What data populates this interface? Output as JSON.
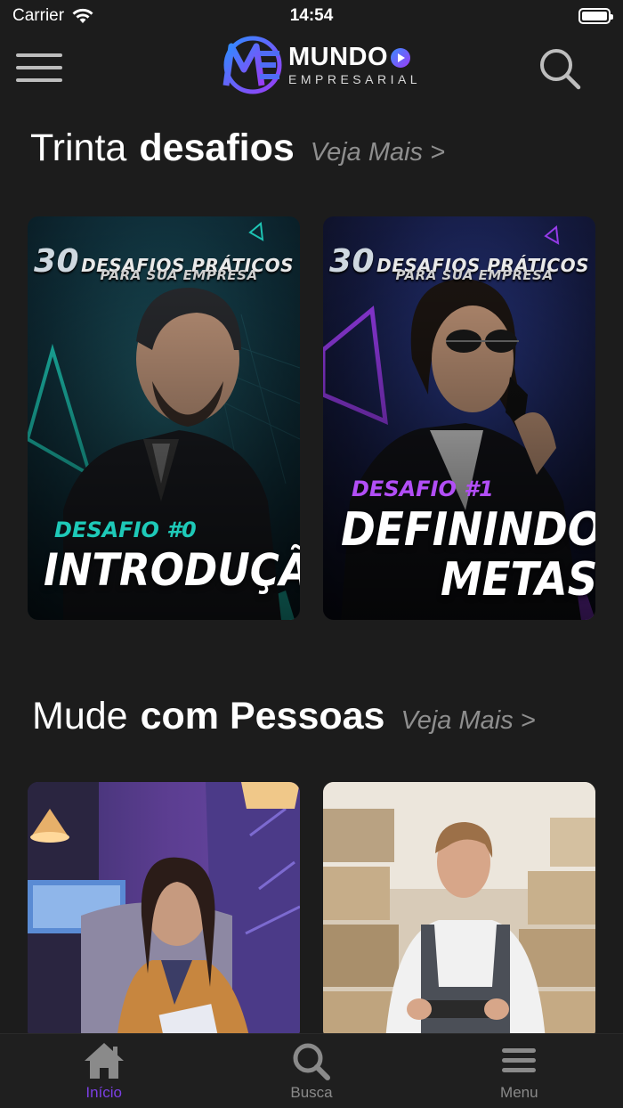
{
  "status_bar": {
    "carrier": "Carrier",
    "time": "14:54"
  },
  "header": {
    "logo_main": "MUNDO",
    "logo_sub": "EMPRESARIAL",
    "logo_initials": "ME",
    "menu_icon": "hamburger-icon",
    "search_icon": "search-icon"
  },
  "sections": [
    {
      "title_light": "Trinta",
      "title_bold": "desafios",
      "see_more": "Veja Mais >",
      "cards": [
        {
          "banner_number": "30",
          "banner_line1": "DESAFIOS PRÁTICOS",
          "banner_line2": "PARA SUA EMPRESA",
          "label": "DESAFIO #0",
          "headline": "INTRODUÇÃO!"
        },
        {
          "banner_number": "30",
          "banner_line1": "DESAFIOS PRÁTICOS",
          "banner_line2": "PARA SUA EMPRESA",
          "label": "DESAFIO #1",
          "headline_line1": "DEFININDO",
          "headline_line2": "METAS!"
        }
      ]
    },
    {
      "title_light": "Mude",
      "title_bold": "com Pessoas",
      "see_more": "Veja Mais >",
      "cards": [
        {
          "image": "woman-at-office-desk-photo"
        },
        {
          "image": "warehouse-worker-photo"
        }
      ]
    }
  ],
  "tab_bar": {
    "tabs": [
      {
        "label": "Início",
        "icon": "home-icon",
        "active": true
      },
      {
        "label": "Busca",
        "icon": "search-icon",
        "active": false
      },
      {
        "label": "Menu",
        "icon": "menu-icon",
        "active": false
      }
    ]
  },
  "colors": {
    "background": "#1c1c1c",
    "accent": "#7b3fe4",
    "teal": "#1ec9b8",
    "purple": "#9a3df0"
  }
}
